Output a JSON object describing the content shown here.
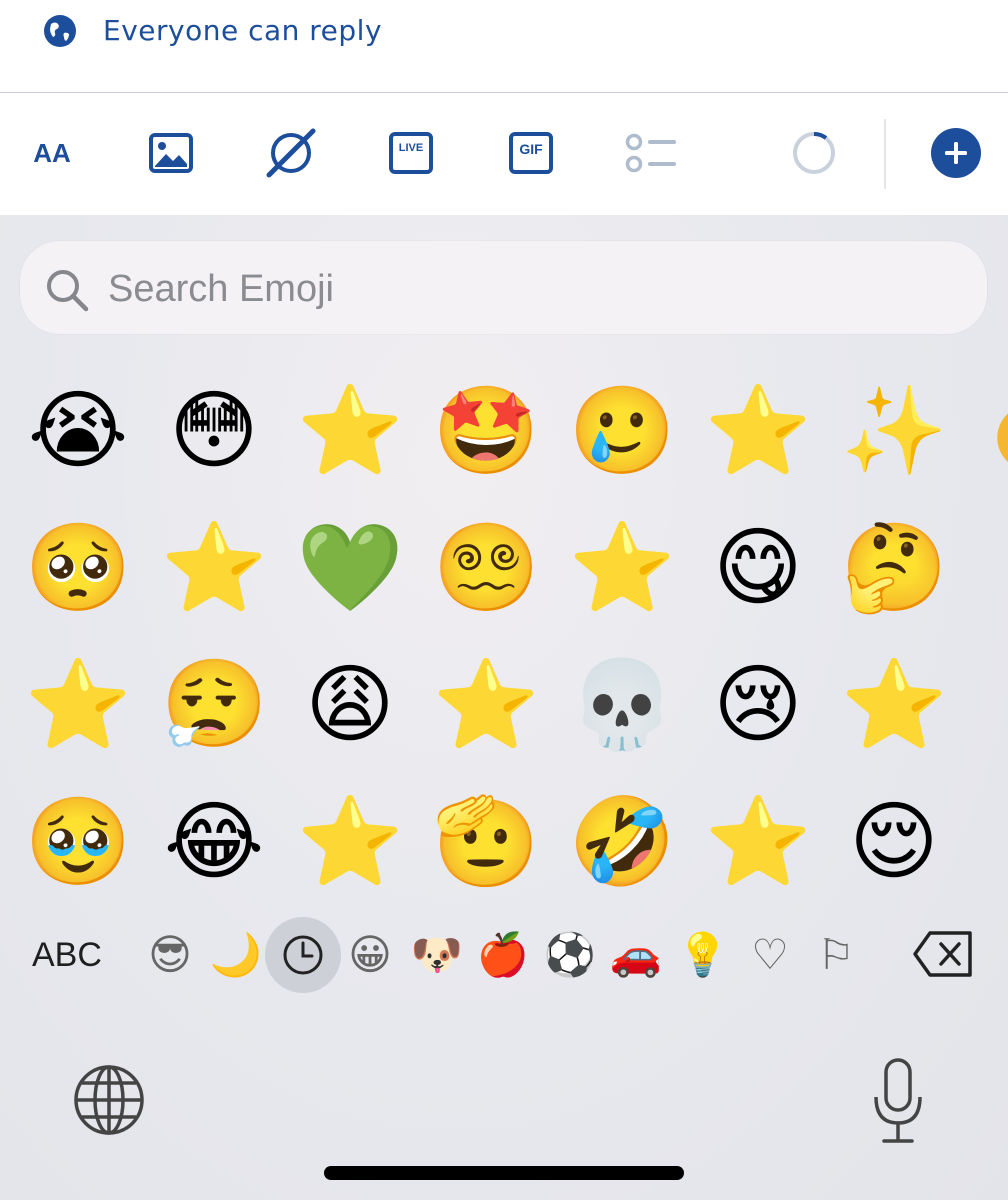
{
  "reply": {
    "label": "Everyone can reply",
    "icon": "globe-icon"
  },
  "toolbar": {
    "accent": "#1d4e9b",
    "text_format_label": "AA",
    "icons": [
      "text-format-icon",
      "image-icon",
      "grok-icon",
      "live-icon",
      "gif-icon",
      "poll-icon",
      "character-count-ring-icon",
      "add-post-icon"
    ],
    "live_label": "LIVE",
    "gif_label": "GIF"
  },
  "emoji_keyboard": {
    "search_placeholder": "Search Emoji",
    "recent_emojis": [
      "😭",
      "😳",
      "⭐",
      "🤩",
      "🥲",
      "⭐",
      "✨",
      "🥺",
      "⭐",
      "💚",
      "😵‍💫",
      "⭐",
      "😋",
      "🤔",
      "⭐",
      "😮‍💨",
      "😩",
      "⭐",
      "💀",
      "😢",
      "⭐",
      "🥹",
      "😂",
      "⭐",
      "🫡",
      "🤣",
      "⭐",
      "😌"
    ],
    "categories": {
      "abc_label": "ABC",
      "items": [
        "😎",
        "🌙",
        "🕘",
        "😀",
        "🐶",
        "🍎",
        "⚽",
        "🚗",
        "💡",
        "♡",
        "⚐"
      ],
      "active": "recents"
    },
    "delete_icon": "delete-icon",
    "globe_icon": "globe-icon",
    "mic_icon": "microphone-icon"
  }
}
